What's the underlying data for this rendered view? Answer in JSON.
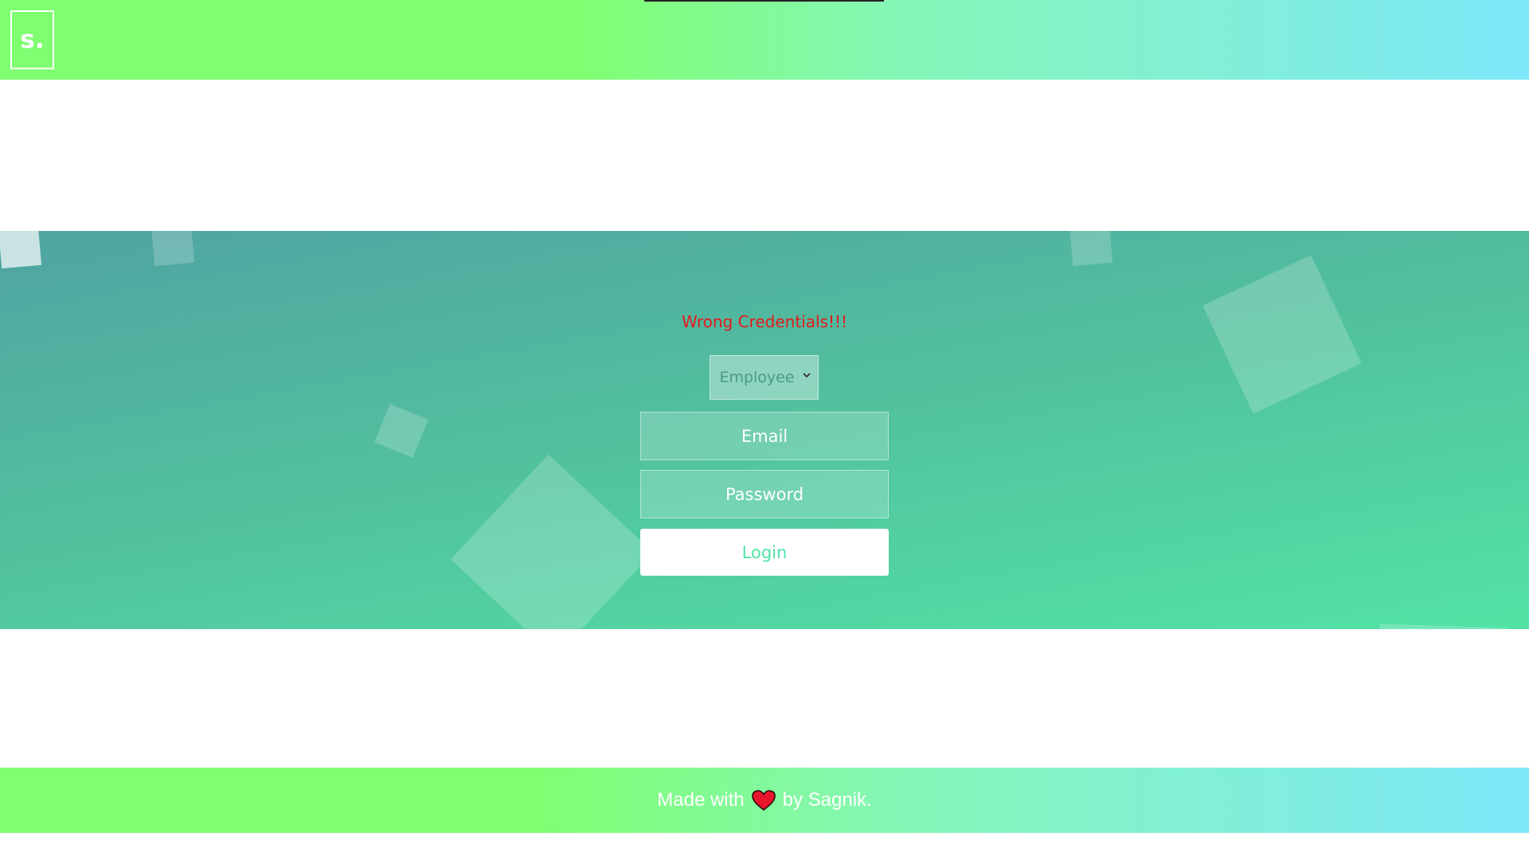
{
  "header": {
    "logo_text": "s."
  },
  "login": {
    "error_message": "Wrong Credentials!!!",
    "role_select": {
      "selected": "Employee",
      "options": [
        "Employee"
      ]
    },
    "email_placeholder": "Email",
    "password_placeholder": "Password",
    "login_label": "Login"
  },
  "footer": {
    "prefix": "Made with",
    "icon": "heart-icon",
    "suffix": "by Sagnik.",
    "heart_color": "#e8162c"
  },
  "colors": {
    "header_gradient_start": "#80ff72",
    "header_gradient_end": "#7ee8fa",
    "hero_gradient_start": "#50a3a2",
    "hero_gradient_end": "#53e3a6",
    "error": "#e31b1b",
    "login_text": "#53e3a6"
  }
}
